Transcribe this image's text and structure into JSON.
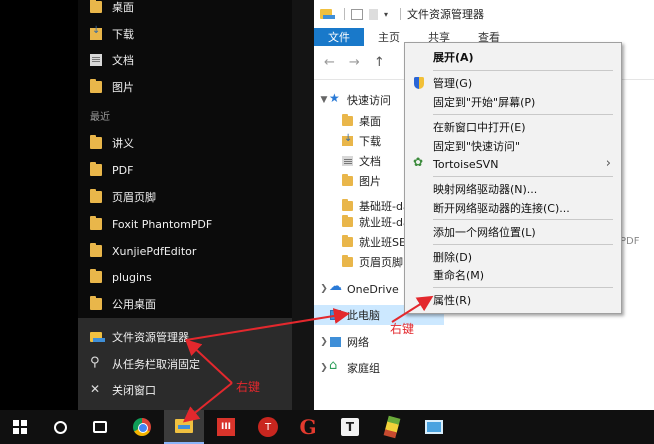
{
  "jumplist": {
    "pinned": [
      "桌面",
      "下载",
      "文档",
      "图片"
    ],
    "recent_heading": "最近",
    "recent": [
      "讲义",
      "PDF",
      "页眉页脚",
      "Foxit PhantomPDF",
      "XunjiePdfEditor",
      "plugins",
      "公用桌面"
    ],
    "actions": [
      "文件资源管理器",
      "从任务栏取消固定",
      "关闭窗口"
    ]
  },
  "explorer": {
    "title": "文件资源管理器",
    "tabs": [
      "文件",
      "主页",
      "共享",
      "查看"
    ],
    "nav": {
      "quick_access": "快速访问",
      "quick_items": [
        "桌面",
        "下载",
        "文档",
        "图片",
        "基础班-da",
        "就业班-da",
        "就业班SE",
        "页眉页脚"
      ],
      "onedrive": "OneDrive",
      "this_pc": "此电脑",
      "network": "网络",
      "homegroup": "家庭组"
    },
    "right_text": "PDF"
  },
  "context_menu": {
    "items": [
      "展开(A)",
      "管理(G)",
      "固定到\"开始\"屏幕(P)",
      "在新窗口中打开(E)",
      "固定到\"快速访问\"",
      "TortoiseSVN",
      "映射网络驱动器(N)...",
      "断开网络驱动器的连接(C)...",
      "添加一个网络位置(L)",
      "删除(D)",
      "重命名(M)",
      "属性(R)"
    ]
  },
  "annotations": {
    "right_click_1": "右键",
    "right_click_2": "右键"
  },
  "taskbar": {
    "icons": [
      "windows-icon",
      "cortana-icon",
      "task-view-icon",
      "chrome-icon",
      "file-explorer-icon",
      "red-app-icon",
      "red-round-app-icon",
      "red-g-app-icon",
      "typora-icon",
      "pencil-app-icon",
      "screen-app-icon"
    ],
    "labels": {
      "red_app": "III",
      "red_round": "T",
      "typora": "T"
    }
  }
}
